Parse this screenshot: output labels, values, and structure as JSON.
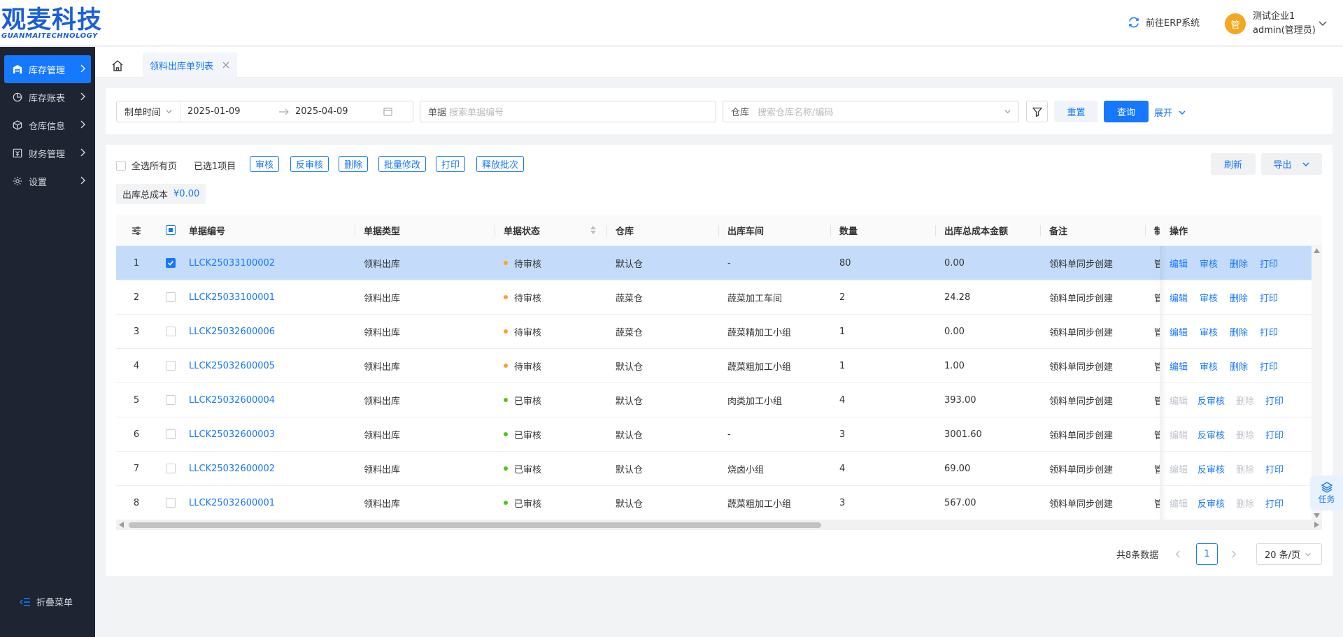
{
  "header": {
    "logo_main": "观麦科技",
    "logo_sub": "GUANMAITECHNOLOGY",
    "erp_link": "前往ERP系统",
    "avatar_char": "管",
    "company": "测试企业1",
    "user": "admin(管理员)"
  },
  "sidebar": {
    "items": [
      {
        "label": "库存管理",
        "icon": "warehouse-icon"
      },
      {
        "label": "库存账表",
        "icon": "pie-chart-icon"
      },
      {
        "label": "仓库信息",
        "icon": "cube-icon"
      },
      {
        "label": "财务管理",
        "icon": "finance-icon"
      },
      {
        "label": "设置",
        "icon": "gear-icon"
      }
    ],
    "collapse_label": "折叠菜单"
  },
  "tabs": {
    "active_label": "领料出库单列表"
  },
  "filters": {
    "date_type": "制单时间",
    "date_start": "2025-01-09",
    "date_end": "2025-04-09",
    "doc_label": "单据",
    "doc_placeholder": "搜索单据编号",
    "wh_label": "仓库",
    "wh_placeholder": "搜索仓库名称/编码",
    "reset": "重置",
    "query": "查询",
    "expand": "展开"
  },
  "toolbar": {
    "select_all": "全选所有页",
    "selected": "已选1项目",
    "approve": "审核",
    "unapprove": "反审核",
    "delete": "删除",
    "batch_edit": "批量修改",
    "print": "打印",
    "release": "释放批次",
    "refresh": "刷新",
    "export": "导出",
    "total_cost_label": "出库总成本",
    "total_cost_value": "¥0.00"
  },
  "table": {
    "columns": [
      "单据编号",
      "单据类型",
      "单据状态",
      "仓库",
      "出库车间",
      "数量",
      "出库总成本金额",
      "备注",
      "制",
      "操作"
    ],
    "rows": [
      {
        "no": "1",
        "id": "LLCK25033100002",
        "type": "领料出库",
        "status": "待审核",
        "wh": "默认仓",
        "ws": "-",
        "qty": "80",
        "cost": "0.00",
        "note": "领料单同步创建",
        "extra": "管",
        "approved": false
      },
      {
        "no": "2",
        "id": "LLCK25033100001",
        "type": "领料出库",
        "status": "待审核",
        "wh": "蔬菜仓",
        "ws": "蔬菜加工车间",
        "qty": "2",
        "cost": "24.28",
        "note": "领料单同步创建",
        "extra": "管",
        "approved": false
      },
      {
        "no": "3",
        "id": "LLCK25032600006",
        "type": "领料出库",
        "status": "待审核",
        "wh": "蔬菜仓",
        "ws": "蔬菜精加工小组",
        "qty": "1",
        "cost": "0.00",
        "note": "领料单同步创建",
        "extra": "管",
        "approved": false
      },
      {
        "no": "4",
        "id": "LLCK25032600005",
        "type": "领料出库",
        "status": "待审核",
        "wh": "默认仓",
        "ws": "蔬菜粗加工小组",
        "qty": "1",
        "cost": "1.00",
        "note": "领料单同步创建",
        "extra": "管",
        "approved": false
      },
      {
        "no": "5",
        "id": "LLCK25032600004",
        "type": "领料出库",
        "status": "已审核",
        "wh": "默认仓",
        "ws": "肉类加工小组",
        "qty": "4",
        "cost": "393.00",
        "note": "领料单同步创建",
        "extra": "管",
        "approved": true
      },
      {
        "no": "6",
        "id": "LLCK25032600003",
        "type": "领料出库",
        "status": "已审核",
        "wh": "默认仓",
        "ws": "-",
        "qty": "3",
        "cost": "3001.60",
        "note": "领料单同步创建",
        "extra": "管",
        "approved": true
      },
      {
        "no": "7",
        "id": "LLCK25032600002",
        "type": "领料出库",
        "status": "已审核",
        "wh": "默认仓",
        "ws": "烧卤小组",
        "qty": "4",
        "cost": "69.00",
        "note": "领料单同步创建",
        "extra": "管",
        "approved": true
      },
      {
        "no": "8",
        "id": "LLCK25032600001",
        "type": "领料出库",
        "status": "已审核",
        "wh": "默认仓",
        "ws": "蔬菜粗加工小组",
        "qty": "3",
        "cost": "567.00",
        "note": "领料单同步创建",
        "extra": "管",
        "approved": true
      }
    ],
    "ops": {
      "edit": "编辑",
      "approve": "审核",
      "unapprove": "反审核",
      "delete": "删除",
      "print": "打印"
    }
  },
  "pagination": {
    "total": "共8条数据",
    "page": "1",
    "page_size": "20 条/页"
  },
  "task": "任务",
  "colors": {
    "primary": "#1677ff",
    "pending": "#f5a623",
    "approved": "#52c41a"
  }
}
